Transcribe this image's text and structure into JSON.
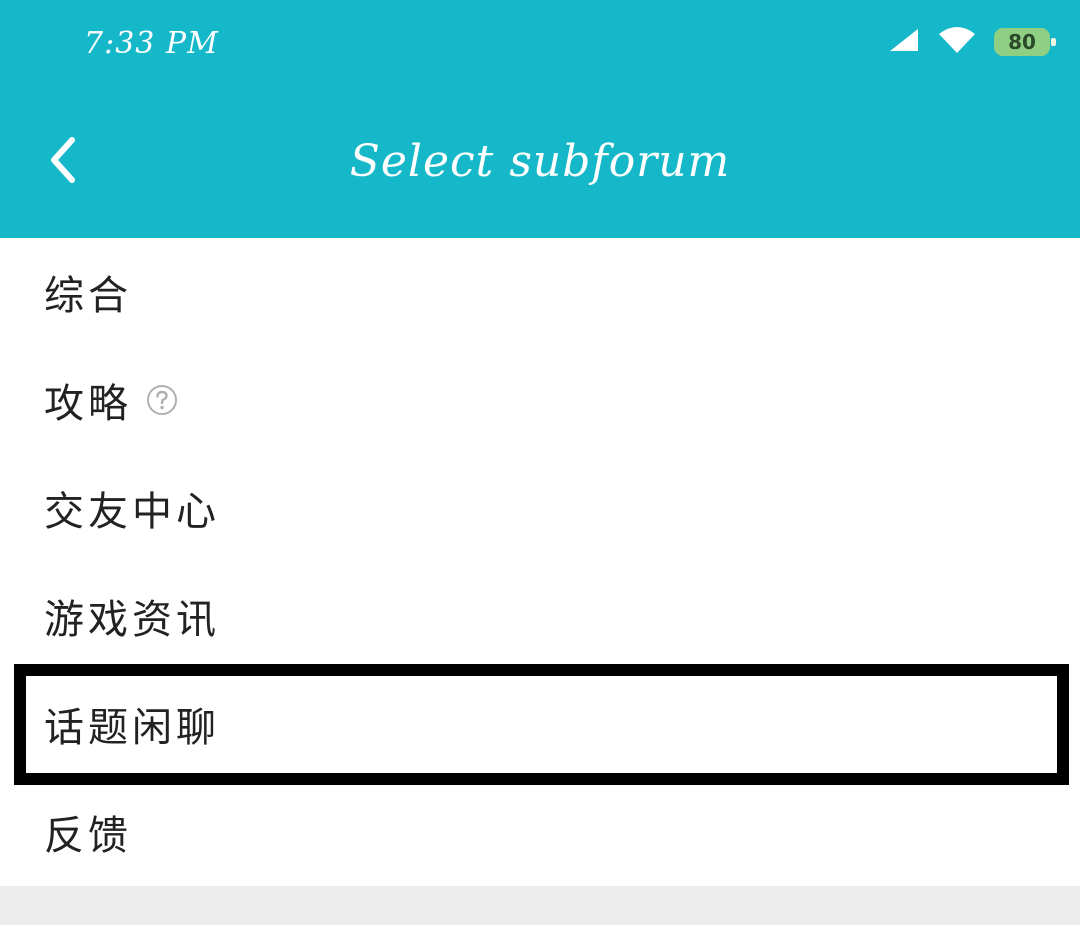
{
  "status_bar": {
    "time": "7:33 PM",
    "battery": "80"
  },
  "toolbar": {
    "title": "Select subforum",
    "back_icon": "chevron-left-icon"
  },
  "subforums": [
    {
      "label": "综合"
    },
    {
      "label": "攻略",
      "icon": "help-circle-icon"
    },
    {
      "label": "交友中心"
    },
    {
      "label": "游戏资讯"
    },
    {
      "label": "话题闲聊",
      "highlighted": true
    },
    {
      "label": "反馈"
    }
  ],
  "colors": {
    "header_bg": "#15b8c8",
    "list_bg": "#ffffff",
    "page_bg": "#ececec",
    "highlight_border": "#000000"
  }
}
